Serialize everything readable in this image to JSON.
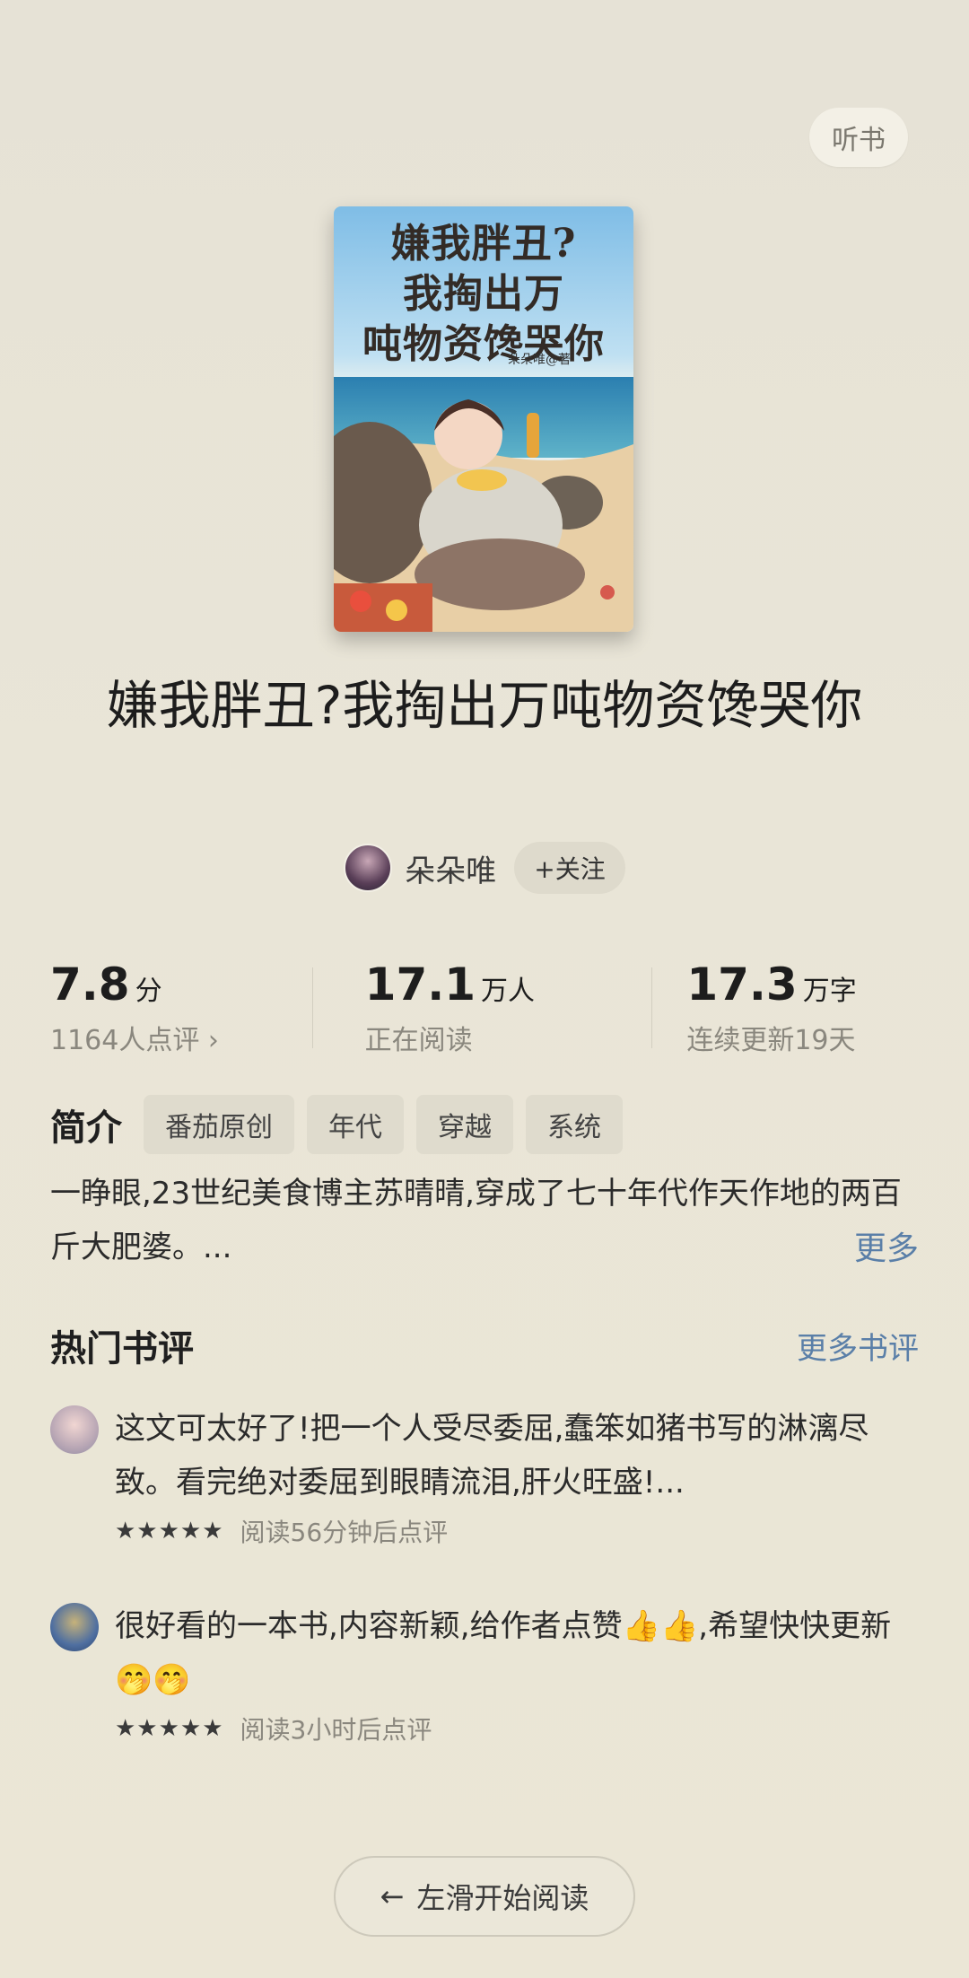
{
  "header": {
    "listen_label": "听书"
  },
  "cover": {
    "title_lines": [
      "嫌我胖丑?",
      "我掏出万",
      "吨物资馋哭你"
    ],
    "author_tag": "朵朵唯@著"
  },
  "book": {
    "title": "嫌我胖丑?我掏出万吨物资馋哭你",
    "author": "朵朵唯",
    "follow_label": "+关注"
  },
  "stats": {
    "rating_value": "7.8",
    "rating_unit": "分",
    "rating_sub": "1164人点评 ›",
    "readers_value": "17.1",
    "readers_unit": "万人",
    "readers_sub": "正在阅读",
    "words_value": "17.3",
    "words_unit": "万字",
    "words_sub": "连续更新19天"
  },
  "intro": {
    "title": "简介",
    "tags": [
      "番茄原创",
      "年代",
      "穿越",
      "系统"
    ],
    "text": "一睁眼,23世纪美食博主苏晴晴,穿成了七十年代作天作地的两百斤大肥婆。...",
    "more_label": "更多"
  },
  "reviews": {
    "title": "热门书评",
    "more_label": "更多书评",
    "items": [
      {
        "text": "这文可太好了!把一个人受尽委屈,蠢笨如猪书写的淋漓尽致。看完绝对委屈到眼睛流泪,肝火旺盛!...",
        "stars": "★★★★★",
        "time": "阅读56分钟后点评"
      },
      {
        "text": "很好看的一本书,内容新颖,给作者点赞👍👍,希望快快更新🤭🤭",
        "stars": "★★★★★",
        "time": "阅读3小时后点评"
      }
    ]
  },
  "bottom": {
    "start_label": "左滑开始阅读",
    "arrow": "←"
  },
  "colors": {
    "accent_link": "#5a7fa8",
    "background": "#e9e5d7"
  }
}
